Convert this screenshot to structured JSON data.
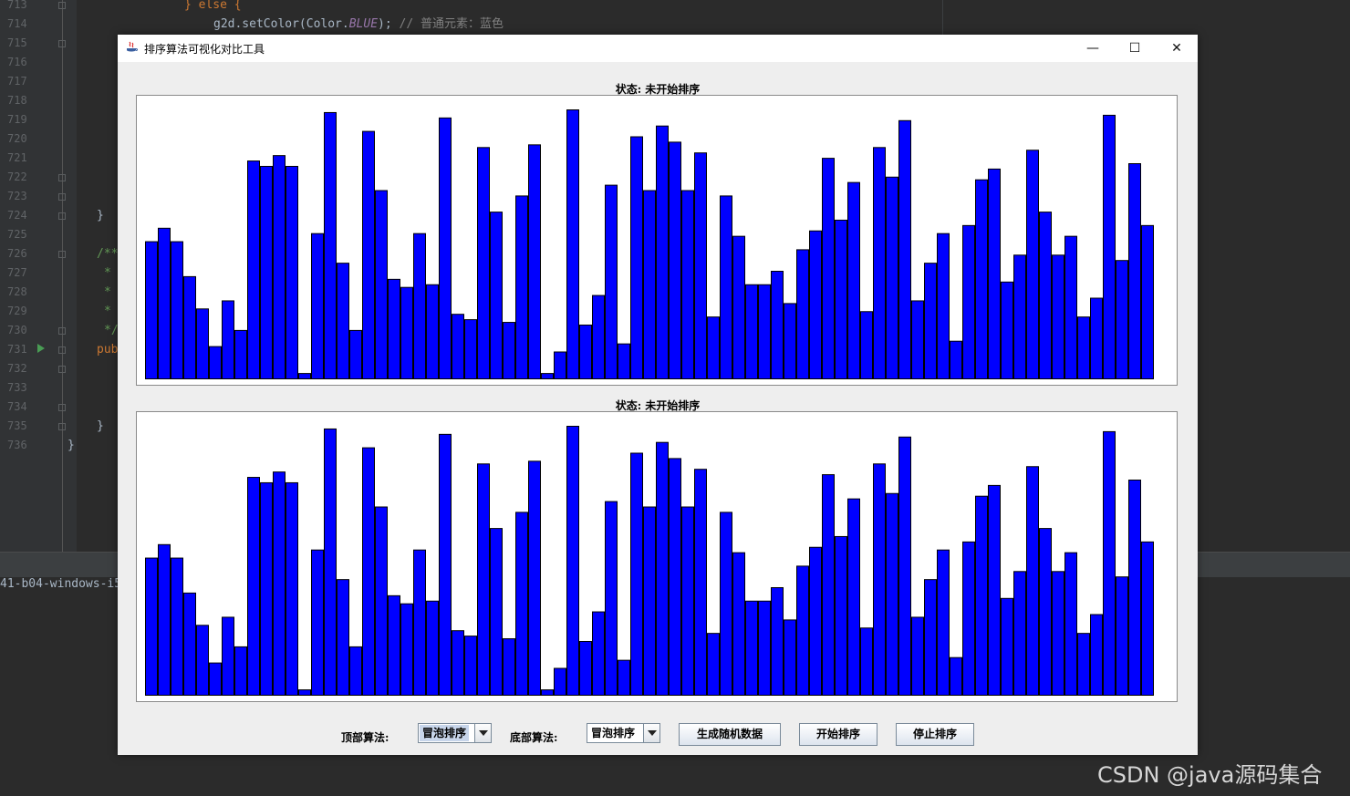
{
  "ide": {
    "line_numbers": [
      "713",
      "714",
      "715",
      "716",
      "717",
      "718",
      "719",
      "720",
      "721",
      "722",
      "723",
      "724",
      "725",
      "726",
      "727",
      "728",
      "729",
      "730",
      "731",
      "732",
      "733",
      "734",
      "735",
      "736"
    ],
    "code_lines": {
      "else_line": "} else {",
      "setcolor_prefix": "g2d.setColor(Color.",
      "setcolor_const": "BLUE",
      "setcolor_suffix": ");",
      "setcolor_comment": " // 普通元素：蓝色",
      "brace_724": "}",
      "javadoc_open": "/**",
      "javadoc_star": "*",
      "javadoc_close": "*/",
      "pub": "pub",
      "brace_735": "}",
      "brace_736": "}"
    },
    "console_text": "41-b04-windows-i5",
    "watermark": "CSDN @java源码集合"
  },
  "window": {
    "title": "排序算法可视化对比工具",
    "minimize_glyph": "—",
    "maximize_glyph": "☐",
    "close_glyph": "✕"
  },
  "top_panel": {
    "status": "状态: 未开始排序"
  },
  "bottom_panel": {
    "status": "状态: 未开始排序"
  },
  "controls": {
    "top_algo_label": "顶部算法:",
    "top_algo_value": "冒泡排序",
    "bottom_algo_label": "底部算法:",
    "bottom_algo_value": "冒泡排序",
    "generate_button": "生成随机数据",
    "start_button": "开始排序",
    "stop_button": "停止排序"
  },
  "colors": {
    "bar_fill": "#0000ff",
    "bar_stroke": "#000000"
  },
  "chart_data": {
    "type": "bar",
    "ylim": [
      0,
      100
    ],
    "values": [
      51,
      56,
      51,
      38,
      26,
      12,
      29,
      18,
      81,
      79,
      83,
      79,
      2,
      54,
      99,
      43,
      18,
      92,
      70,
      37,
      34,
      54,
      35,
      97,
      24,
      22,
      86,
      62,
      21,
      68,
      87,
      2,
      10,
      100,
      20,
      31,
      72,
      13,
      90,
      70,
      94,
      88,
      70,
      84,
      23,
      68,
      53,
      35,
      35,
      40,
      28,
      48,
      55,
      82,
      59,
      73,
      25,
      86,
      75,
      96,
      29,
      43,
      54,
      14,
      57,
      74,
      78,
      36,
      46,
      85,
      62,
      46,
      53,
      23,
      30,
      98,
      44,
      80,
      57
    ]
  }
}
